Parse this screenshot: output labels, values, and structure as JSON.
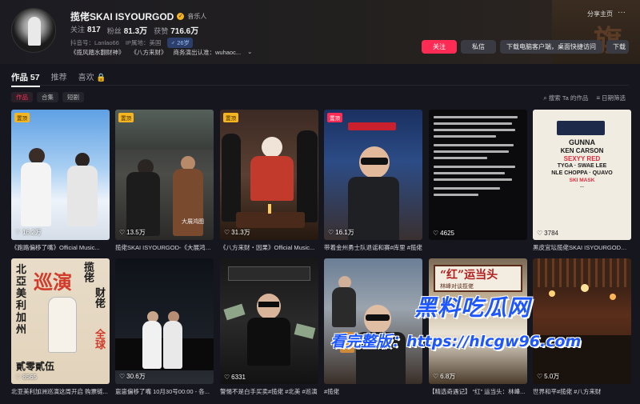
{
  "profile": {
    "name": "揽佬SKAI ISYOURGOD",
    "verify_label": "音乐人",
    "stats": [
      {
        "label": "关注",
        "value": "817"
      },
      {
        "label": "粉丝",
        "value": "81.3万"
      },
      {
        "label": "获赞",
        "value": "716.6万"
      }
    ],
    "douyin_id": "抖音号：Lanlao66",
    "ip": "IP属地：美国",
    "age": "26岁",
    "bio": [
      "《揽风踏水翻财神》",
      "《八方来财》",
      "商务演出认准：wuhaoc..."
    ]
  },
  "header_actions": {
    "share": "分享主页",
    "more": "···",
    "follow": "关注",
    "message": "私信",
    "download_client": "下载电脑客户端，桌面快捷访问",
    "download": "下载"
  },
  "tabs": [
    {
      "label": "作品 57",
      "active": true
    },
    {
      "label": "推荐",
      "active": false
    },
    {
      "label": "喜欢 🔒",
      "active": false
    }
  ],
  "filter_chips": [
    {
      "label": "作品",
      "active": true
    },
    {
      "label": "合集",
      "active": false
    },
    {
      "label": "短剧",
      "active": false
    }
  ],
  "tools": {
    "search": "搜索 Ta 的作品",
    "sort": "日期筛选"
  },
  "videos": [
    {
      "likes": "16.2万",
      "caption": "《跑路偏移了嘴》Official Music...",
      "pinned": true
    },
    {
      "likes": "13.5万",
      "caption": "揽佬SKAI ISYOURGOD-《大展鸿图...",
      "pinned": true,
      "overlay": "大展鸿图"
    },
    {
      "likes": "31.3万",
      "caption": "《八方来财・因果》Official Music...",
      "pinned": true
    },
    {
      "likes": "16.1万",
      "caption": "带着金州勇士队退谣和赛#库里 #揽佬",
      "pinned": true
    },
    {
      "likes": "4625",
      "caption": "",
      "pinned": false
    },
    {
      "likes": "3784",
      "caption": "黑皮宜坛揽佬SKAI ISYOURGOD来了...",
      "pinned": false
    },
    {
      "likes": "8565",
      "caption": "北亚美利加洲巡演这周开启 购票链...",
      "pinned": false,
      "poster": [
        "北",
        "亞",
        "美",
        "利",
        "加",
        "州"
      ],
      "poster_big": "巡演",
      "poster_side": "揽佬",
      "poster_side2": "财佬",
      "poster_bottom": "貳零貳伍",
      "poster_red": "全球"
    },
    {
      "likes": "30.6万",
      "caption": "崽崽偏移了嘴 10月30号00:00 - 各...",
      "pinned": false
    },
    {
      "likes": "6331",
      "caption": "警惕不是白手买卖#揽佬 #北美 #巡演",
      "pinned": false
    },
    {
      "likes": "",
      "caption": "#揽佬",
      "pinned": false
    },
    {
      "likes": "6.8万",
      "caption": "【精选奇遇记】 “红” 运当头：林峰...",
      "pinned": false,
      "sign": "“红”运当头",
      "sign_sub": "林峰对谈揽佬"
    },
    {
      "likes": "5.0万",
      "caption": "世界和平#揽佬 #八方来财",
      "pinned": false
    }
  ],
  "lineup": [
    "GUNNA",
    "KEN CARSON",
    "SEXYY RED",
    "TYGA · SWAE LEE",
    "NLE CHOPPA · QUAVO",
    "SKI MASK",
    "..."
  ],
  "pin_label": "置顶",
  "watermark": {
    "line1": "黑料吃瓜网",
    "line2": "看完整版：https://hlcgw96.com"
  },
  "header_art_char": "旗"
}
